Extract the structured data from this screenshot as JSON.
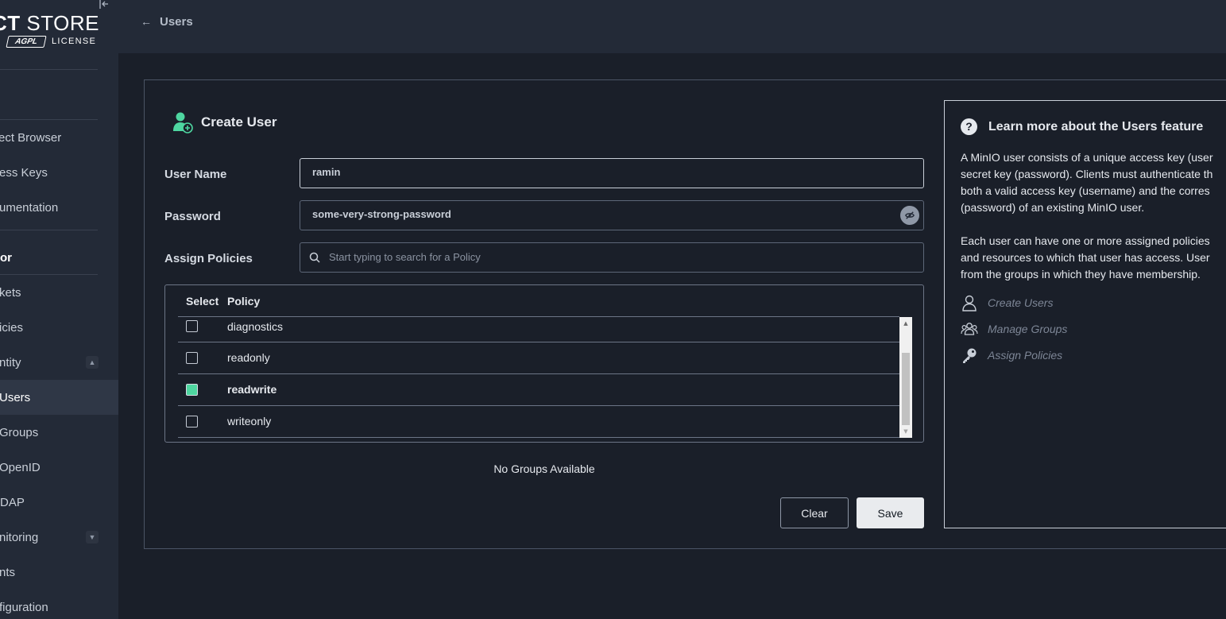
{
  "sidebar": {
    "logo_bold": "CT",
    "logo_light": "STORE",
    "badge": "AGPL",
    "license": "LICENSE",
    "items": [
      {
        "label": "ect Browser"
      },
      {
        "label": "ess Keys"
      },
      {
        "label": "umentation"
      }
    ],
    "section": "or",
    "admin_items": [
      {
        "label": "kets"
      },
      {
        "label": "icies"
      },
      {
        "label": "ntity"
      },
      {
        "label": "Users"
      },
      {
        "label": "Groups"
      },
      {
        "label": "OpenID"
      },
      {
        "label": "DAP"
      },
      {
        "label": "nitoring"
      },
      {
        "label": "nts"
      },
      {
        "label": "figuration"
      }
    ]
  },
  "topbar": {
    "back_label": "Users"
  },
  "form": {
    "title": "Create User",
    "username_label": "User Name",
    "username_value": "ramin",
    "password_label": "Password",
    "password_value": "some-very-strong-password",
    "policies_label": "Assign Policies",
    "policies_placeholder": "Start typing to search for a Policy",
    "table": {
      "headers": [
        "Select",
        "Policy"
      ],
      "rows": [
        {
          "label": "diagnostics",
          "checked": false
        },
        {
          "label": "readonly",
          "checked": false
        },
        {
          "label": "readwrite",
          "checked": true
        },
        {
          "label": "writeonly",
          "checked": false
        }
      ]
    },
    "no_groups": "No Groups Available",
    "clear_label": "Clear",
    "save_label": "Save"
  },
  "help": {
    "title": "Learn more about the Users feature",
    "para1": [
      "A MinIO user consists of a unique access key (user",
      "secret key (password). Clients must authenticate th",
      "both a valid access key (username) and the corres",
      "(password) of an existing MinIO user."
    ],
    "para2": [
      "Each user can have one or more assigned policies",
      "and resources to which that user has access. User",
      "from the groups in which they have membership."
    ],
    "links": [
      {
        "label": "Create Users",
        "icon": "user-icon"
      },
      {
        "label": "Manage Groups",
        "icon": "group-icon"
      },
      {
        "label": "Assign Policies",
        "icon": "key-icon"
      }
    ]
  },
  "colors": {
    "accent_green": "#4ed6a0",
    "background": "#1a1f29",
    "sidebar": "#232a37"
  }
}
